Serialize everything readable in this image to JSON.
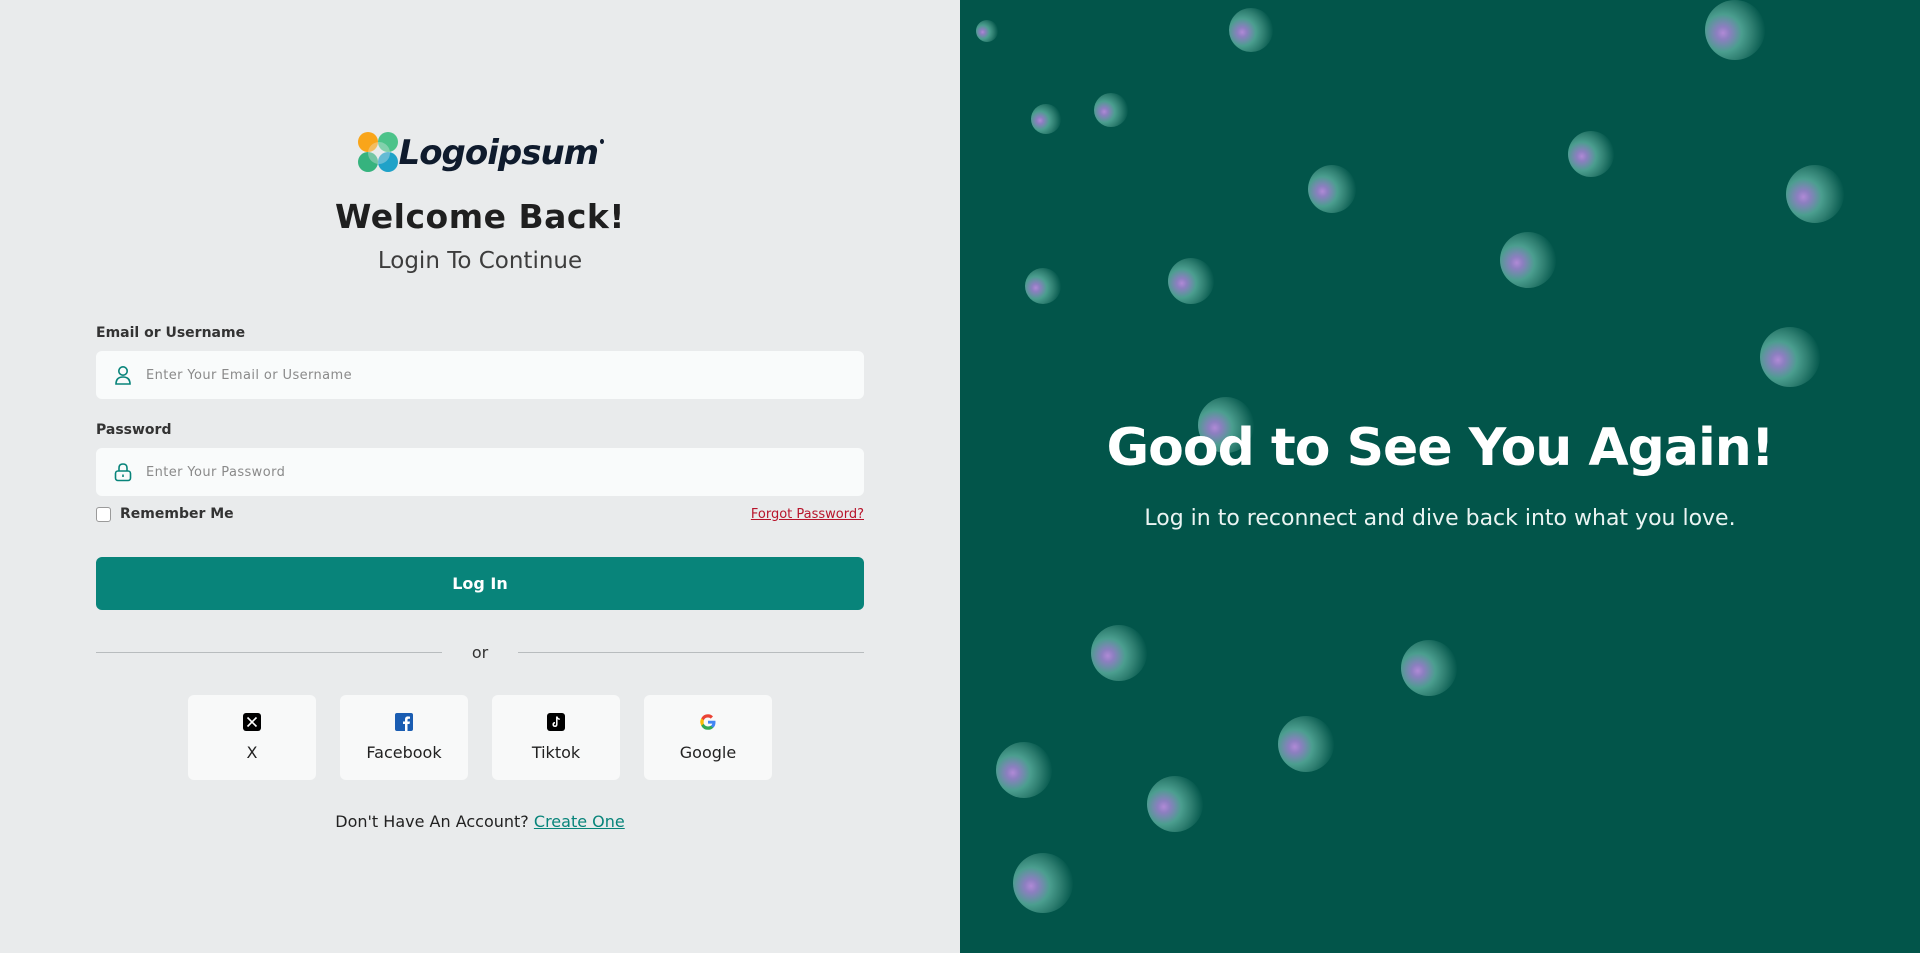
{
  "brand": {
    "name": "Logoipsum"
  },
  "form": {
    "title": "Welcome Back!",
    "subtitle": "Login To Continue",
    "email_label": "Email or Username",
    "email_placeholder": "Enter Your Email or Username",
    "password_label": "Password",
    "password_placeholder": "Enter Your Password",
    "remember_label": "Remember Me",
    "remember_checked": false,
    "forgot_label": "Forgot Password?",
    "login_label": "Log In",
    "divider_label": "or"
  },
  "social": [
    {
      "name": "X",
      "icon": "x-icon"
    },
    {
      "name": "Facebook",
      "icon": "facebook-icon"
    },
    {
      "name": "Tiktok",
      "icon": "tiktok-icon"
    },
    {
      "name": "Google",
      "icon": "google-icon"
    }
  ],
  "signup": {
    "prompt": "Don't Have An Account?",
    "link": "Create One"
  },
  "hero": {
    "title": "Good to See You Again!",
    "subtitle": "Log in to reconnect and dive back into what you love."
  },
  "colors": {
    "primary": "#08847a",
    "hero_bg": "#02554a",
    "page_bg": "#e9ebec",
    "link_red": "#b8142b"
  }
}
